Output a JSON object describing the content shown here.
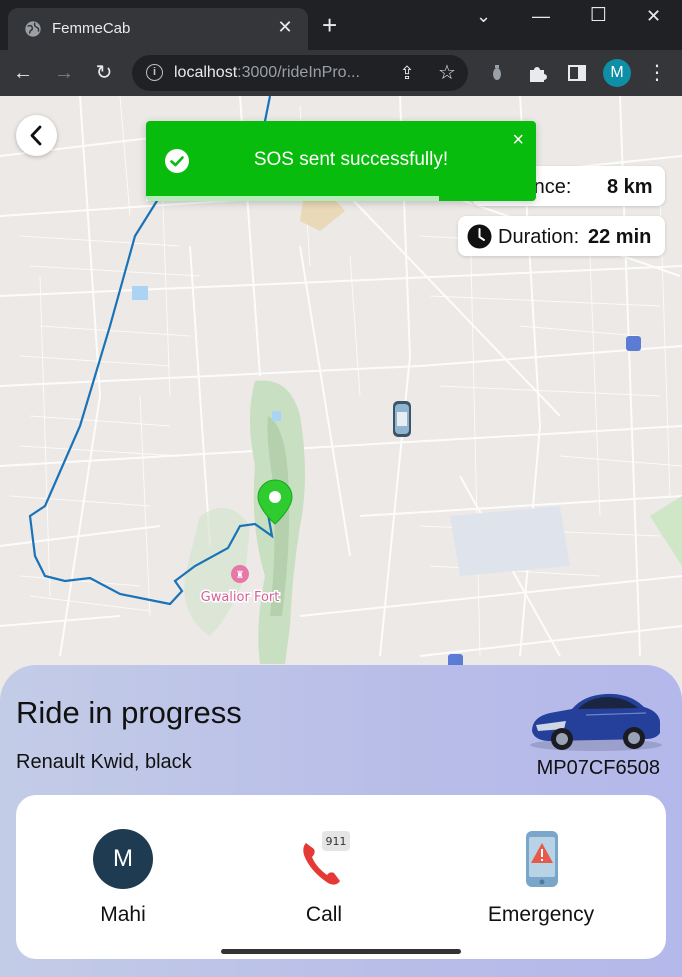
{
  "browser": {
    "tab_title": "FemmeCab",
    "url_host": "localhost",
    "url_rest": ":3000/rideInPro...",
    "profile_initial": "M"
  },
  "toast": {
    "message": "SOS sent successfully!",
    "close": "×",
    "progress": 0.75
  },
  "stats": {
    "distance_label": "Distance:",
    "distance_value": "8 km",
    "duration_label": "Duration:",
    "duration_value": "22 min"
  },
  "map": {
    "place_label": "Gwalior Fort"
  },
  "ride": {
    "title": "Ride in progress",
    "car": "Renault Kwid, black",
    "plate": "MP07CF6508"
  },
  "actions": [
    {
      "label": "Mahi",
      "initial": "M"
    },
    {
      "label": "Call",
      "badge": "911"
    },
    {
      "label": "Emergency"
    }
  ],
  "colors": {
    "toast": "#07bc0c",
    "route": "#1a73b8",
    "pin": "#2ecc2e",
    "avatar": "#1f3b52"
  }
}
